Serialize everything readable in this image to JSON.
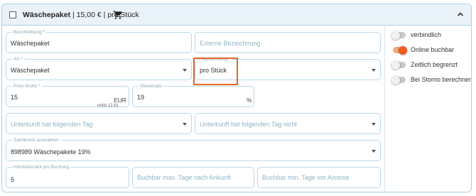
{
  "header": {
    "title": "Wäschepaket",
    "price": "15,00 €",
    "price_unit": "pro Stück",
    "separator": "|",
    "cart_icon": "cart-icon",
    "collapse_icon": "chevron-up-icon"
  },
  "fields": {
    "beschreibung": {
      "label": "Beschreibung *",
      "value": "Wäschepaket"
    },
    "externe_bezeichnung": {
      "placeholder": "Externe Bezeichnung"
    },
    "art": {
      "label": "Art *",
      "value": "Wäschepaket"
    },
    "berechnung": {
      "label": "Berechnung *",
      "value": "pro Stück"
    },
    "preis_brutto": {
      "label": "Preis brutto *",
      "value": "15",
      "unit": "EUR",
      "netto": "netto 12.61"
    },
    "steuersatz": {
      "label": "Steuersatz",
      "value": "19",
      "unit": "%"
    },
    "tag_1": {
      "placeholder": "Unterkunft hat folgenden Tag"
    },
    "tag_2": {
      "placeholder": "Unterkunft hat folgenden Tag nicht"
    },
    "sachkonto": {
      "label": "Sachkonto auswählen",
      "value": "898989 Wäschepakete 19%"
    },
    "hoechstanzahl": {
      "label": "Höchstanzahl pro Buchung",
      "value": "5"
    },
    "buchbar_max": {
      "placeholder": "Buchbar max. Tage nach Ankunft"
    },
    "buchbar_min": {
      "placeholder": "Buchbar min. Tage vor Anreise"
    }
  },
  "toggles": [
    {
      "label": "verbindlich",
      "on": false
    },
    {
      "label": "Online buchbar",
      "on": true
    },
    {
      "label": "Zeitlich begrenzt",
      "on": false
    },
    {
      "label": "Bei Storno berechnen",
      "on": false
    }
  ],
  "colors": {
    "accent": "#f15a22",
    "highlight_box": "#e8642a",
    "border": "#b8d8e8",
    "header_bg": "#eaf3f9"
  }
}
